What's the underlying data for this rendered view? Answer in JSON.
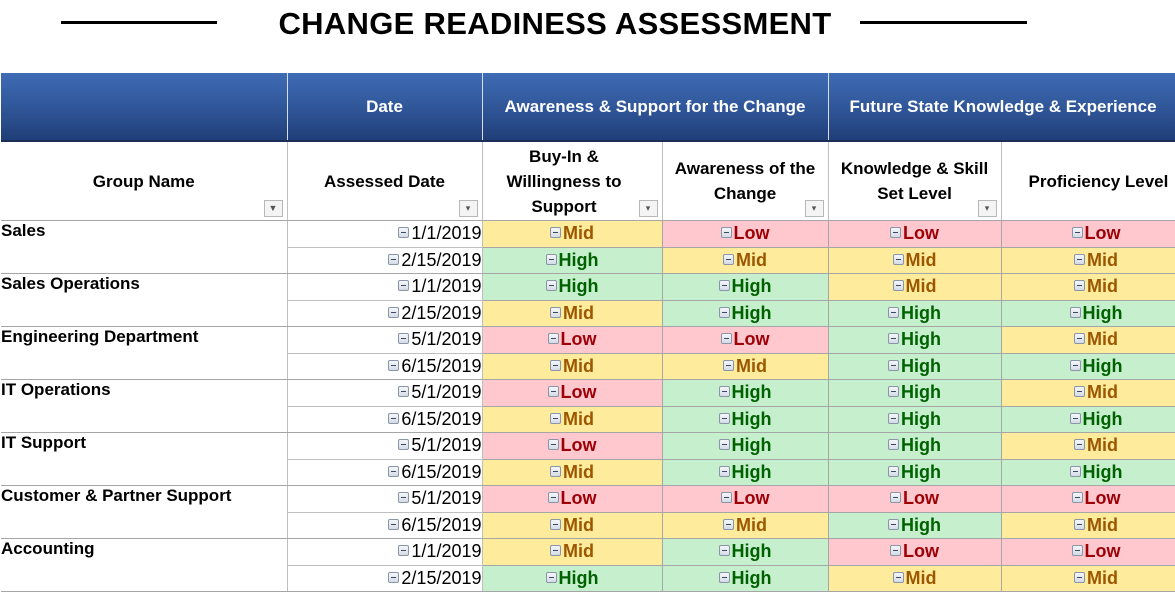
{
  "title": "CHANGE READINESS ASSESSMENT",
  "band_headers": {
    "blank": "",
    "date": "Date",
    "awareness_group": "Awareness & Support for the Change",
    "future_group": "Future State Knowledge & Experience"
  },
  "columns": {
    "group_name": "Group Name",
    "assessed_date": "Assessed Date",
    "buy_in": "Buy-In & Willingness to Support",
    "awareness": "Awareness of the Change",
    "knowledge": "Knowledge & Skill Set Level",
    "proficiency": "Proficiency Level"
  },
  "level_colors": {
    "High": {
      "bg": "#c6efce",
      "fg": "#006100"
    },
    "Mid": {
      "bg": "#ffeb9c",
      "fg": "#9c5700"
    },
    "Low": {
      "bg": "#ffc7ce",
      "fg": "#9c0006"
    }
  },
  "groups": [
    {
      "name": "Sales",
      "rows": [
        {
          "date": "1/1/2019",
          "buy_in": "Mid",
          "awareness": "Low",
          "knowledge": "Low",
          "proficiency": "Low"
        },
        {
          "date": "2/15/2019",
          "buy_in": "High",
          "awareness": "Mid",
          "knowledge": "Mid",
          "proficiency": "Mid"
        }
      ]
    },
    {
      "name": "Sales Operations",
      "rows": [
        {
          "date": "1/1/2019",
          "buy_in": "High",
          "awareness": "High",
          "knowledge": "Mid",
          "proficiency": "Mid"
        },
        {
          "date": "2/15/2019",
          "buy_in": "Mid",
          "awareness": "High",
          "knowledge": "High",
          "proficiency": "High"
        }
      ]
    },
    {
      "name": "Engineering Department",
      "rows": [
        {
          "date": "5/1/2019",
          "buy_in": "Low",
          "awareness": "Low",
          "knowledge": "High",
          "proficiency": "Mid"
        },
        {
          "date": "6/15/2019",
          "buy_in": "Mid",
          "awareness": "Mid",
          "knowledge": "High",
          "proficiency": "High"
        }
      ]
    },
    {
      "name": "IT Operations",
      "rows": [
        {
          "date": "5/1/2019",
          "buy_in": "Low",
          "awareness": "High",
          "knowledge": "High",
          "proficiency": "Mid"
        },
        {
          "date": "6/15/2019",
          "buy_in": "Mid",
          "awareness": "High",
          "knowledge": "High",
          "proficiency": "High"
        }
      ]
    },
    {
      "name": "IT Support",
      "rows": [
        {
          "date": "5/1/2019",
          "buy_in": "Low",
          "awareness": "High",
          "knowledge": "High",
          "proficiency": "Mid"
        },
        {
          "date": "6/15/2019",
          "buy_in": "Mid",
          "awareness": "High",
          "knowledge": "High",
          "proficiency": "High"
        }
      ]
    },
    {
      "name": "Customer & Partner Support",
      "rows": [
        {
          "date": "5/1/2019",
          "buy_in": "Low",
          "awareness": "Low",
          "knowledge": "Low",
          "proficiency": "Low"
        },
        {
          "date": "6/15/2019",
          "buy_in": "Mid",
          "awareness": "Mid",
          "knowledge": "High",
          "proficiency": "Mid"
        }
      ]
    },
    {
      "name": "Accounting",
      "rows": [
        {
          "date": "1/1/2019",
          "buy_in": "Mid",
          "awareness": "High",
          "knowledge": "Low",
          "proficiency": "Low"
        },
        {
          "date": "2/15/2019",
          "buy_in": "High",
          "awareness": "High",
          "knowledge": "Mid",
          "proficiency": "Mid"
        }
      ]
    }
  ],
  "icons": {
    "filter_applied": "filter-applied-icon",
    "dropdown": "dropdown-arrow-icon",
    "collapse": "collapse-minus-icon"
  }
}
